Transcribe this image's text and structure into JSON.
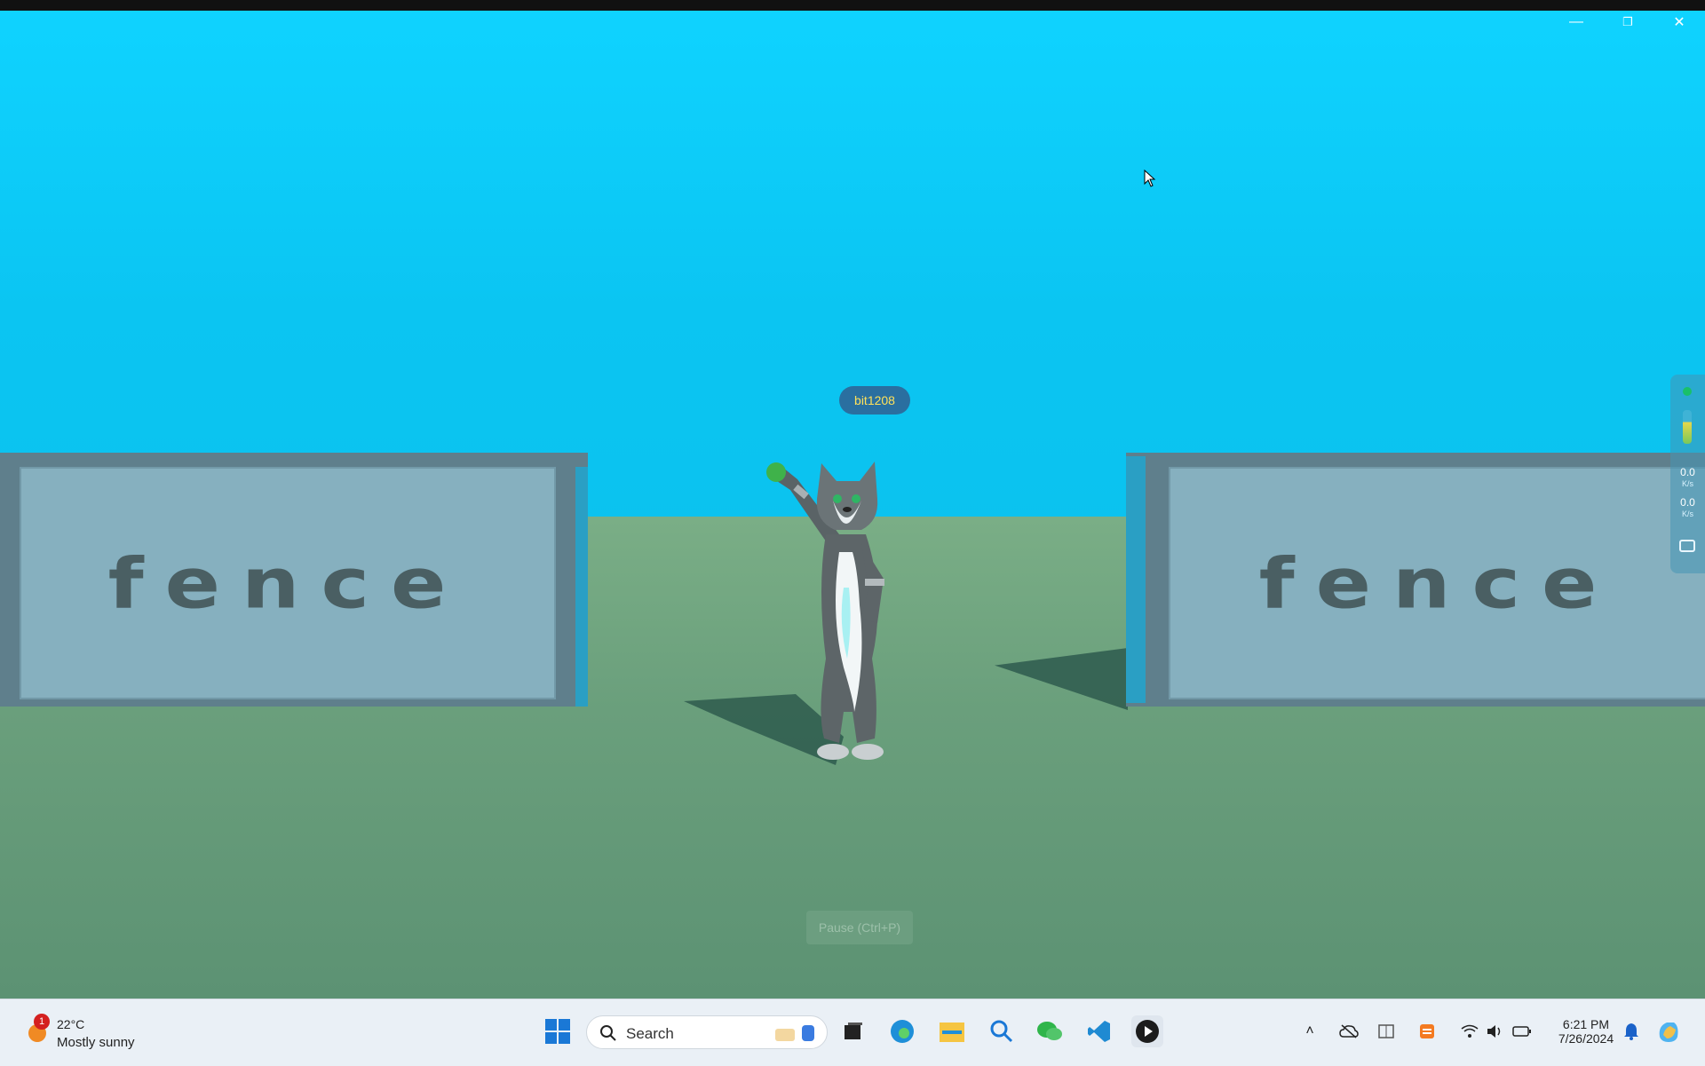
{
  "window": {
    "controls": [
      "minimize",
      "restore",
      "close"
    ]
  },
  "scene": {
    "player_name": "bit1208",
    "left_wall_text": "fence",
    "right_wall_text": "fence",
    "pause_label": "Pause (Ctrl+P)"
  },
  "side_panel": {
    "status_color": "#19c06a",
    "upload_value": "0.0",
    "upload_unit": "K/s",
    "download_value": "0.0",
    "download_unit": "K/s"
  },
  "taskbar": {
    "weather": {
      "temp": "22°C",
      "condition": "Mostly sunny",
      "badge": "1"
    },
    "search_placeholder": "Search",
    "pinned": [
      "start-icon",
      "search-glass-icon",
      "task-view-icon",
      "edge-icon",
      "file-explorer-icon",
      "magnifier-icon",
      "wechat-icon",
      "vscode-icon",
      "media-player-icon"
    ],
    "tray": {
      "time": "6:21 PM",
      "date": "7/26/2024"
    }
  },
  "colors": {
    "sky": "#0fd3ff",
    "ground": "#6a9f7c",
    "nametag_text": "#ffe15a"
  }
}
